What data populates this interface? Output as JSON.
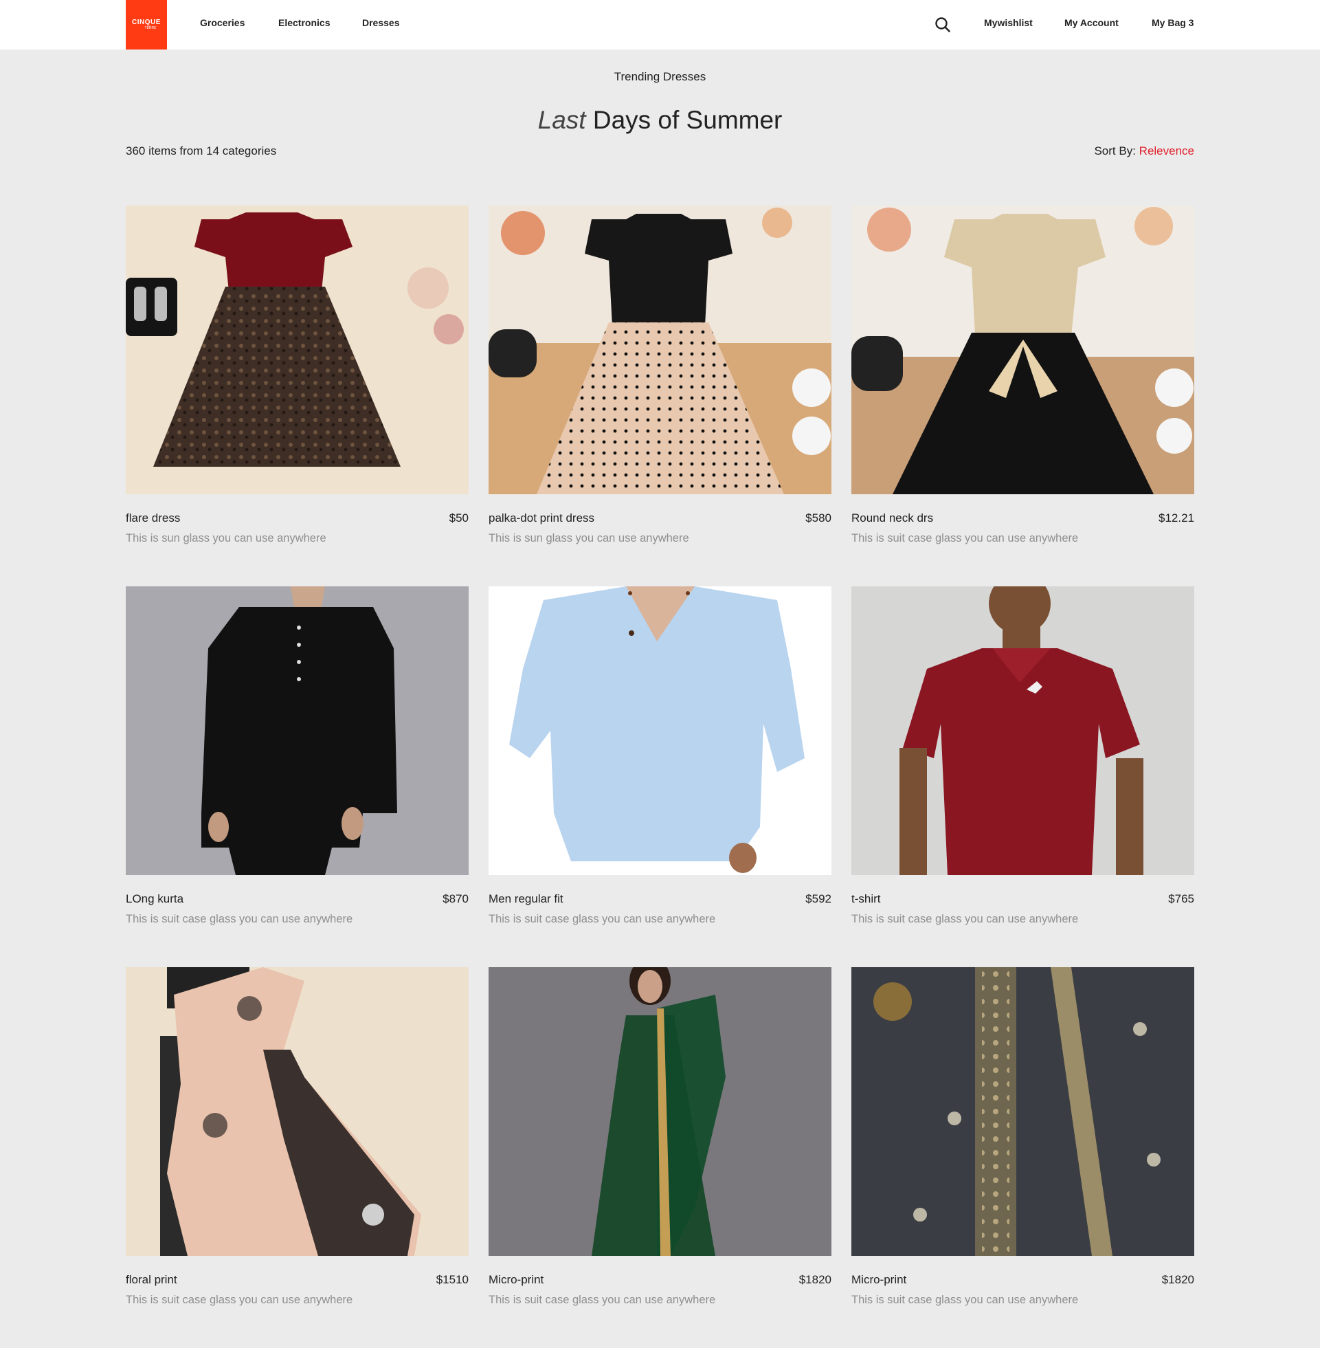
{
  "brand": {
    "logo_line1": "CINQUE",
    "logo_line2": "TERRE",
    "logo_color": "#ff3b13"
  },
  "nav": {
    "left": [
      {
        "label": "Groceries"
      },
      {
        "label": "Electronics"
      },
      {
        "label": "Dresses"
      }
    ],
    "search_icon": "search-icon",
    "right": [
      {
        "label": "Mywishlist"
      },
      {
        "label": "My Account"
      },
      {
        "label": "My Bag 3"
      }
    ]
  },
  "page": {
    "eyebrow": "Trending Dresses",
    "hero_italic": "Last",
    "hero_rest": "Days of Summer",
    "count": "360 items from 14 categories",
    "sort_label": "Sort By:",
    "sort_value": "Relevence",
    "accent_color": "#e0222d"
  },
  "products": [
    {
      "name": "flare dress",
      "price": "$50",
      "desc": "This is sun glass you can use anywhere",
      "image": "red top leopard tulle girls dress"
    },
    {
      "name": "palka-dot print dress",
      "price": "$580",
      "desc": "This is sun glass you can use anywhere",
      "image": "black top polka-dot tulle girls dress"
    },
    {
      "name": "Round neck drs",
      "price": "$12.21",
      "desc": "This is suit case glass you can use anywhere",
      "image": "beige ruffle top black tulle girls dress"
    },
    {
      "name": "LOng kurta",
      "price": "$870",
      "desc": "This is suit case glass you can use anywhere",
      "image": "man in black kurta"
    },
    {
      "name": "Men regular fit",
      "price": "$592",
      "desc": "This is suit case glass you can use anywhere",
      "image": "man in light blue shirt"
    },
    {
      "name": "t-shirt",
      "price": "$765",
      "desc": "This is suit case glass you can use anywhere",
      "image": "man in maroon polo t-shirt"
    },
    {
      "name": "floral print",
      "price": "$1510",
      "desc": "This is suit case glass you can use anywhere",
      "image": "woman in floral satin saree"
    },
    {
      "name": "Micro-print",
      "price": "$1820",
      "desc": "This is suit case glass you can use anywhere",
      "image": "woman in green anarkali"
    },
    {
      "name": "Micro-print",
      "price": "$1820",
      "desc": "This is suit case glass you can use anywhere",
      "image": "dark grey embroidered fabric"
    }
  ]
}
